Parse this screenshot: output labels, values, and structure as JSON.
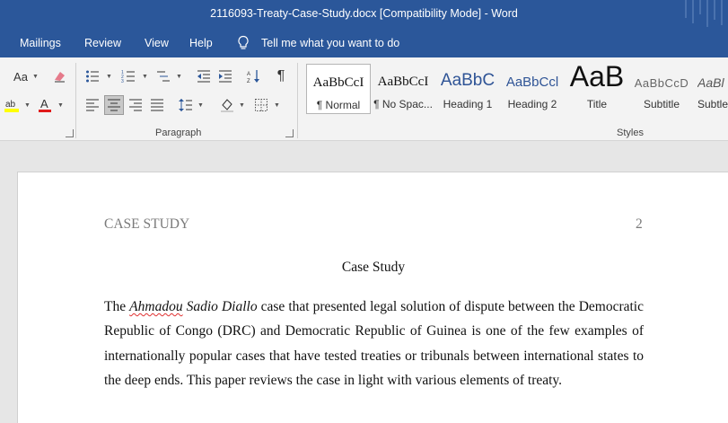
{
  "window": {
    "title": "2116093-Treaty-Case-Study.docx [Compatibility Mode]  -  Word"
  },
  "menubar": {
    "tabs": [
      "Mailings",
      "Review",
      "View",
      "Help"
    ],
    "tell_me": "Tell me what you want to do"
  },
  "ribbon": {
    "paragraph_group_label": "Paragraph",
    "styles_group_label": "Styles",
    "font_size_label": "Aa",
    "highlight_color": "#ffff00",
    "font_color": "#e01b1b",
    "styles": [
      {
        "preview": "AaBbCcI",
        "name": "¶ Normal",
        "active": true
      },
      {
        "preview": "AaBbCcI",
        "name": "¶ No Spac..."
      },
      {
        "preview": "AaBbC",
        "name": "Heading 1"
      },
      {
        "preview": "AaBbCcl",
        "name": "Heading 2"
      },
      {
        "preview": "AaB",
        "name": "Title"
      },
      {
        "preview": "AaBbCcD",
        "name": "Subtitle"
      },
      {
        "preview": "AaBl",
        "name": "Subtle"
      }
    ]
  },
  "document": {
    "header": "CASE STUDY",
    "page_number": "2",
    "title": "Case Study",
    "paragraph": {
      "lead": "The ",
      "italic_name_1": "Ahmadou",
      "italic_name_2": " Sadio Diallo",
      "rest": " case that presented legal solution of dispute between the Democratic Republic of Congo (DRC) and Democratic Republic of Guinea is one of the few examples of internationally popular cases that have tested treaties or tribunals between international states to the deep ends. This paper reviews the case in light with various elements of treaty."
    }
  },
  "colors": {
    "accent": "#2b579a",
    "ribbon_bg": "#f3f3f3",
    "doc_bg": "#e6e6e6"
  }
}
